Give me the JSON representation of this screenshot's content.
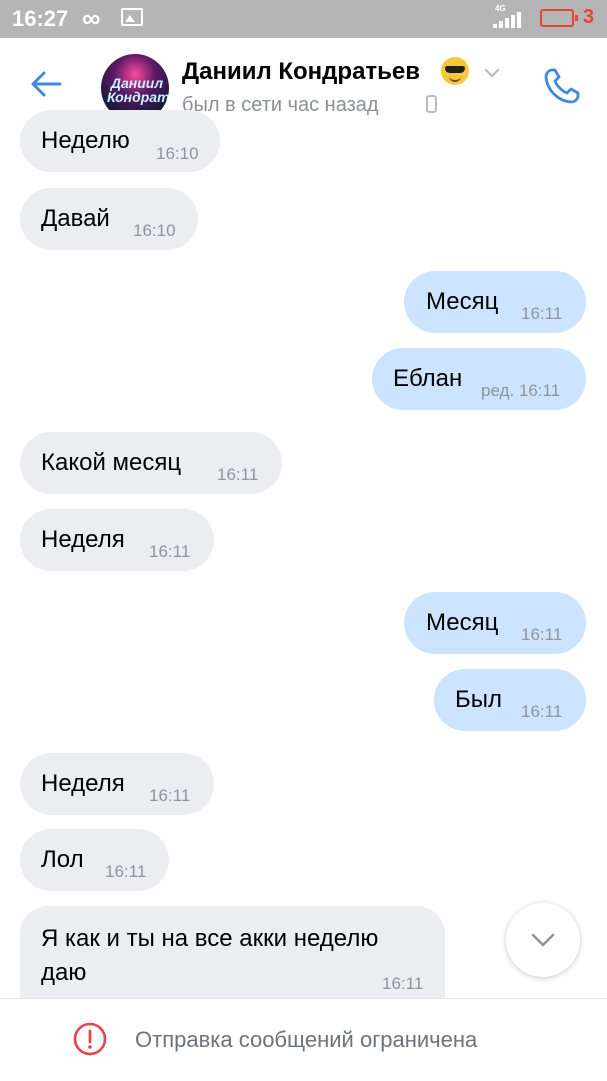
{
  "status_bar": {
    "time": "16:27",
    "infinity": "∞",
    "network": "4G",
    "battery": "3"
  },
  "header": {
    "contact_name": "Даниил Кондратьев",
    "last_seen": "был в сети час назад",
    "avatar_text": "Даниил Кондратьев"
  },
  "messages": [
    {
      "direction": "in",
      "text": "Неделю",
      "time": "16:10"
    },
    {
      "direction": "in",
      "text": "Давай",
      "time": "16:10"
    },
    {
      "direction": "out",
      "text": "Месяц",
      "time": "16:11"
    },
    {
      "direction": "out",
      "text": "Еблан",
      "time": "ред. 16:11"
    },
    {
      "direction": "in",
      "text": "Какой месяц",
      "time": "16:11"
    },
    {
      "direction": "in",
      "text": "Неделя",
      "time": "16:11"
    },
    {
      "direction": "out",
      "text": "Месяц",
      "time": "16:11"
    },
    {
      "direction": "out",
      "text": "Был",
      "time": "16:11"
    },
    {
      "direction": "in",
      "text": "Неделя",
      "time": "16:11"
    },
    {
      "direction": "in",
      "text": "Лол",
      "time": "16:11"
    },
    {
      "direction": "in",
      "text_line1": "Я как и ты на все акки неделю",
      "text_line2": "даю",
      "time": "16:11"
    }
  ],
  "footer": {
    "restricted_text": "Отправка сообщений ограничена"
  },
  "colors": {
    "accent": "#3f8ae0",
    "incoming": "#ebedf0",
    "outgoing": "#cce4ff",
    "warning": "#e64646"
  }
}
